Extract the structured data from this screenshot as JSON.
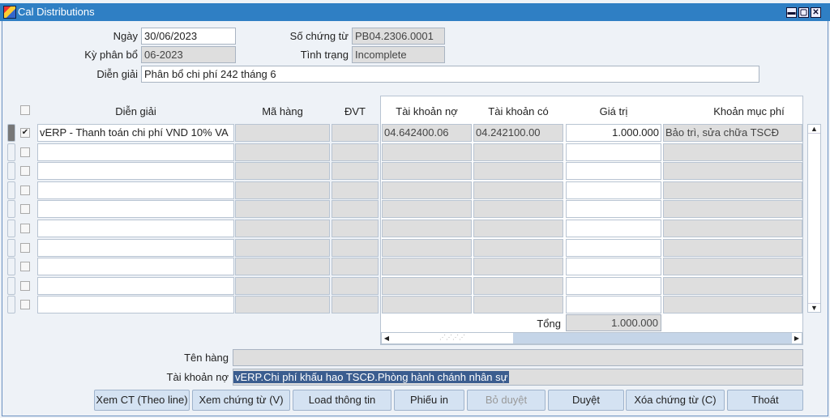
{
  "window": {
    "title": "Cal Distributions",
    "controls": [
      "▬",
      "▢",
      "✕"
    ]
  },
  "header": {
    "date_label": "Ngày",
    "date_value": "30/06/2023",
    "period_label": "Kỳ phân bổ",
    "period_value": "06-2023",
    "voucher_label": "Số chứng từ",
    "voucher_value": "PB04.2306.0001",
    "status_label": "Tình trạng",
    "status_value": "Incomplete",
    "desc_label": "Diễn giải",
    "desc_value": "Phân bổ chi phí 242 tháng 6"
  },
  "table": {
    "columns": {
      "desc": "Diễn giải",
      "item": "Mã hàng",
      "uom": "ĐVT",
      "debit": "Tài khoản nợ",
      "credit": "Tài khoản có",
      "amount": "Giá trị",
      "cost": "Khoản mục phí"
    },
    "rows": [
      {
        "checked": true,
        "desc": "vERP - Thanh toán chi phí VND 10% VA",
        "item": "",
        "uom": "",
        "debit": "04.642400.06",
        "credit": "04.242100.00",
        "amount": "1.000.000",
        "cost": "Bảo trì, sửa chữa TSCĐ"
      },
      {
        "checked": false,
        "desc": "",
        "item": "",
        "uom": "",
        "debit": "",
        "credit": "",
        "amount": "",
        "cost": ""
      },
      {
        "checked": false,
        "desc": "",
        "item": "",
        "uom": "",
        "debit": "",
        "credit": "",
        "amount": "",
        "cost": ""
      },
      {
        "checked": false,
        "desc": "",
        "item": "",
        "uom": "",
        "debit": "",
        "credit": "",
        "amount": "",
        "cost": ""
      },
      {
        "checked": false,
        "desc": "",
        "item": "",
        "uom": "",
        "debit": "",
        "credit": "",
        "amount": "",
        "cost": ""
      },
      {
        "checked": false,
        "desc": "",
        "item": "",
        "uom": "",
        "debit": "",
        "credit": "",
        "amount": "",
        "cost": ""
      },
      {
        "checked": false,
        "desc": "",
        "item": "",
        "uom": "",
        "debit": "",
        "credit": "",
        "amount": "",
        "cost": ""
      },
      {
        "checked": false,
        "desc": "",
        "item": "",
        "uom": "",
        "debit": "",
        "credit": "",
        "amount": "",
        "cost": ""
      },
      {
        "checked": false,
        "desc": "",
        "item": "",
        "uom": "",
        "debit": "",
        "credit": "",
        "amount": "",
        "cost": ""
      },
      {
        "checked": false,
        "desc": "",
        "item": "",
        "uom": "",
        "debit": "",
        "credit": "",
        "amount": "",
        "cost": ""
      }
    ],
    "total_label": "Tổng",
    "total_value": "1.000.000"
  },
  "detail": {
    "item_name_label": "Tên hàng",
    "item_name_value": "",
    "debit_label": "Tài khoản nợ",
    "debit_value": "vERP.Chi phí khấu hao TSCĐ.Phòng hành chánh nhân sự"
  },
  "buttons": [
    {
      "label": "Xem CT (Theo line)",
      "enabled": true
    },
    {
      "label": "Xem chứng từ (V)",
      "enabled": true
    },
    {
      "label": "Load thông tin",
      "enabled": true
    },
    {
      "label": "Phiếu in",
      "enabled": true
    },
    {
      "label": "Bỏ duyệt",
      "enabled": false
    },
    {
      "label": "Duyệt",
      "enabled": true
    },
    {
      "label": "Xóa chứng từ (C)",
      "enabled": true
    },
    {
      "label": "Thoát",
      "enabled": true
    }
  ],
  "colors": {
    "titlebar": "#2f7fc4",
    "selection": "#3b5d8f"
  }
}
